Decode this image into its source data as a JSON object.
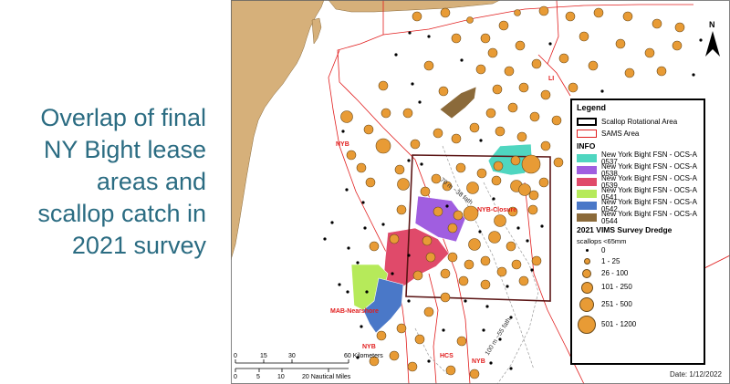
{
  "slide": {
    "title_lines": [
      "Overlap of final",
      "NY Bight lease",
      "areas and",
      "scallop catch in",
      "2021 survey"
    ]
  },
  "map": {
    "colors": {
      "land": "#d6b07a",
      "sea": "#ffffff",
      "sams": "#e11d1d",
      "rotational": "#5b1515",
      "catch": "#e89b35",
      "zero": "#000000",
      "text_title": "#2b6c82"
    },
    "area_labels": [
      "LI",
      "NYB",
      "NYB-Closure",
      "MAB-Nearshore",
      "NYB",
      "HCS",
      "NYB"
    ],
    "contour_labels": [
      "70 m ~38 fath",
      "100 m ~55 fath"
    ],
    "north_arrow": "N",
    "scale_km": {
      "ticks": [
        "0",
        "15",
        "30",
        "60 Kilometers"
      ]
    },
    "scale_nm": {
      "ticks": [
        "0",
        "5",
        "10",
        "20 Nautical Miles"
      ]
    },
    "date": "Date: 1/12/2022"
  },
  "legend": {
    "title": "Legend",
    "items": [
      {
        "label": "Scallop Rotational Area",
        "color": "#000000",
        "kind": "outline"
      },
      {
        "label": "SAMS Area",
        "color": "#e11d1d",
        "kind": "outline-thin"
      }
    ],
    "info_header": "INFO",
    "leases": [
      {
        "label": "New York Bight FSN - OCS-A 0537",
        "color": "#4fd6c0"
      },
      {
        "label": "New York Bight FSN - OCS-A 0538",
        "color": "#a05ee0"
      },
      {
        "label": "New York Bight FSN - OCS-A 0539",
        "color": "#e04a6a"
      },
      {
        "label": "New York Bight FSN - OCS-A 0541",
        "color": "#b6ea5a"
      },
      {
        "label": "New York Bight FSN - OCS-A 0542",
        "color": "#4a78c8"
      },
      {
        "label": "New York Bight FSN - OCS-A 0544",
        "color": "#8b6a3a"
      }
    ],
    "survey_header": "2021 VIMS Survey Dredge",
    "survey_sub": "scallops <65mm",
    "classes": [
      {
        "label": "0",
        "size": 3
      },
      {
        "label": "1 - 25",
        "size": 7
      },
      {
        "label": "26 - 100",
        "size": 10
      },
      {
        "label": "101 - 250",
        "size": 13
      },
      {
        "label": "251 - 500",
        "size": 16
      },
      {
        "label": "501 - 1200",
        "size": 20
      }
    ]
  }
}
